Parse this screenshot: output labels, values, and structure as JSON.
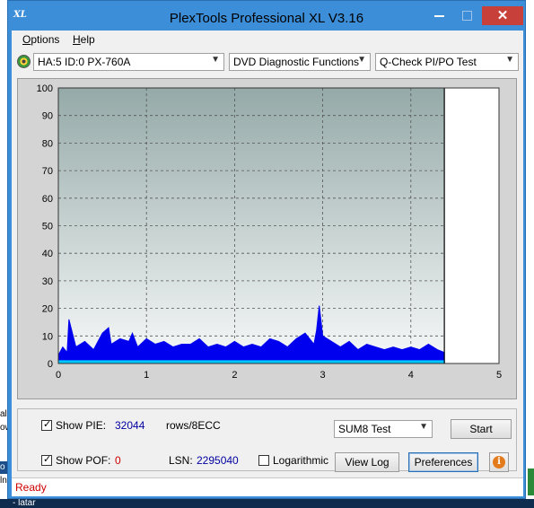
{
  "window": {
    "title": "PlexTools Professional XL V3.16",
    "icon_text": "XL",
    "close_glyph": "✕"
  },
  "menu": {
    "options": {
      "accel": "O",
      "rest": "ptions"
    },
    "help": {
      "accel": "H",
      "rest": "elp"
    }
  },
  "toolbar": {
    "drive": "HA:5 ID:0  PX-760A",
    "function": "DVD Diagnostic Functions",
    "test": "Q-Check PI/PO Test"
  },
  "chart_data": {
    "type": "area",
    "xlim": [
      0,
      5
    ],
    "ylim": [
      0,
      100
    ],
    "x_ticks": [
      "0",
      "1",
      "2",
      "3",
      "4",
      "5"
    ],
    "y_ticks": [
      "0",
      "10",
      "20",
      "30",
      "40",
      "50",
      "60",
      "70",
      "80",
      "90",
      "100"
    ],
    "grid": true,
    "end_marker_x": 4.38,
    "series": [
      {
        "color": "#0000ee",
        "x": [
          0.0,
          0.05,
          0.1,
          0.12,
          0.2,
          0.3,
          0.4,
          0.5,
          0.57,
          0.6,
          0.7,
          0.8,
          0.84,
          0.9,
          1.0,
          1.1,
          1.2,
          1.3,
          1.4,
          1.5,
          1.6,
          1.7,
          1.8,
          1.9,
          2.0,
          2.1,
          2.2,
          2.3,
          2.4,
          2.5,
          2.6,
          2.7,
          2.8,
          2.9,
          2.93,
          2.96,
          3.0,
          3.1,
          3.2,
          3.3,
          3.4,
          3.5,
          3.6,
          3.7,
          3.8,
          3.9,
          4.0,
          4.1,
          4.2,
          4.3,
          4.38
        ],
        "values": [
          3,
          6,
          4,
          16,
          6,
          8,
          5,
          11,
          13,
          7,
          9,
          8,
          11,
          6,
          9,
          7,
          8,
          6,
          7,
          7,
          9,
          6,
          7,
          6,
          8,
          6,
          7,
          6,
          9,
          8,
          6,
          9,
          11,
          7,
          12,
          21,
          10,
          8,
          6,
          8,
          5,
          7,
          6,
          5,
          6,
          5,
          6,
          5,
          7,
          5,
          4
        ]
      },
      {
        "color": "#00c8ff",
        "x": [
          0.0,
          0.5,
          1.0,
          1.5,
          2.0,
          2.5,
          3.0,
          3.5,
          4.0,
          4.38
        ],
        "values": [
          1,
          1,
          1,
          1,
          1,
          1,
          1,
          1,
          1,
          1
        ]
      }
    ]
  },
  "controls": {
    "show_pie_label": "Show PIE:",
    "pie_value": "32044",
    "pie_unit": "rows/8ECC",
    "show_poe_label": "Show POF:",
    "poe_value": "0",
    "lsn_label": "LSN:",
    "lsn_value": "2295040",
    "logarithmic_label": "Logarithmic",
    "test_mode": "SUM8 Test",
    "start_label": "Start",
    "view_log_label": "View Log",
    "preferences_label": "Preferences",
    "info_glyph": "i",
    "checked_glyph": "✓",
    "dropdown_glyph": "▼"
  },
  "status": {
    "text": "Ready"
  },
  "background": {
    "frag_1": "al",
    "frag_2": "ow",
    "frag_3": "o",
    "frag_4": "ln",
    "frag_5": "- latar"
  }
}
